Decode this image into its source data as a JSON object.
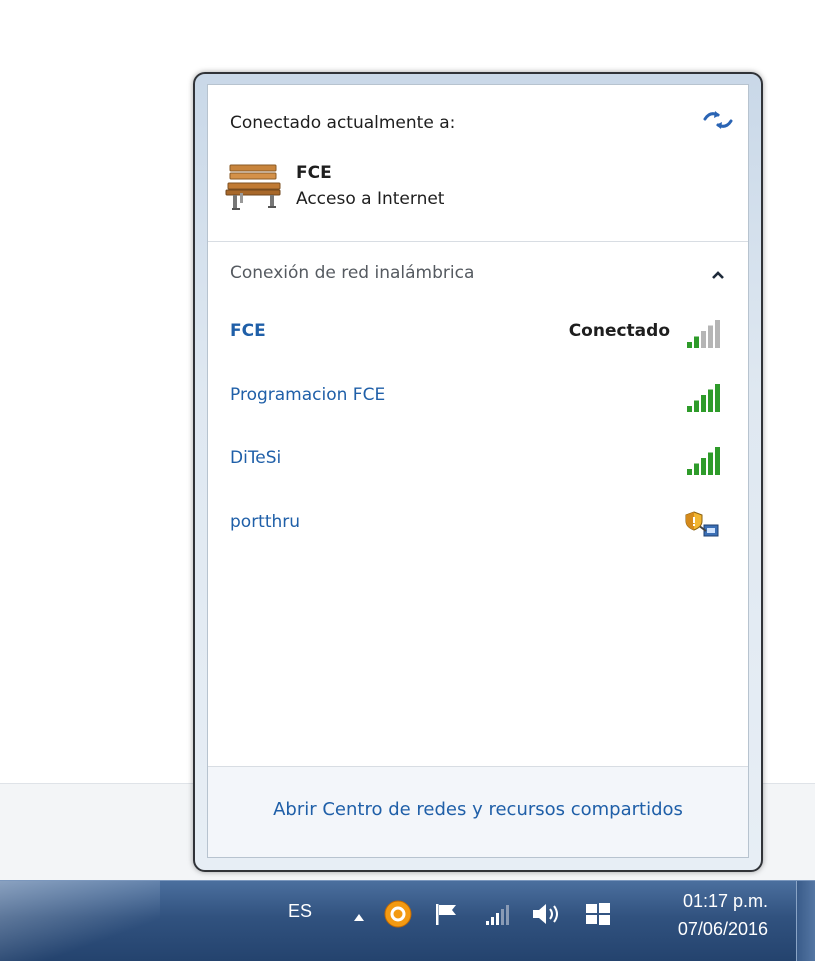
{
  "flyout": {
    "current": {
      "header": "Conectado actualmente a:",
      "network_name": "FCE",
      "network_status": "Acceso a Internet",
      "network_icon": "bench-icon",
      "refresh_icon": "refresh-icon"
    },
    "group": {
      "label": "Conexión de red inalámbrica",
      "collapse_icon": "chevron-up-icon"
    },
    "networks": [
      {
        "name": "FCE",
        "status": "Conectado",
        "signal_bars": 5,
        "signal_strength": 0.4,
        "connected": true
      },
      {
        "name": "Programacion FCE",
        "status": "",
        "signal_bars": 5,
        "signal_strength": 1.0,
        "connected": false
      },
      {
        "name": "DiTeSi",
        "status": "",
        "signal_bars": 5,
        "signal_strength": 1.0,
        "connected": false
      },
      {
        "name": "portthru",
        "status": "",
        "icon": "shield-network-icon",
        "connected": false
      }
    ],
    "footer_link": "Abrir Centro de redes y recursos compartidos"
  },
  "taskbar": {
    "language": "ES",
    "tray_icons": [
      "chevron-up-icon",
      "app-orange-icon",
      "flag-icon",
      "network-signal-icon",
      "speaker-icon",
      "windows-icon"
    ],
    "time": "01:17 p.m.",
    "date": "07/06/2016"
  },
  "colors": {
    "link_blue": "#1f5fa8",
    "signal_green": "#2e9b2a",
    "signal_grey": "#b5b5b5",
    "taskbar": "#31527f"
  }
}
